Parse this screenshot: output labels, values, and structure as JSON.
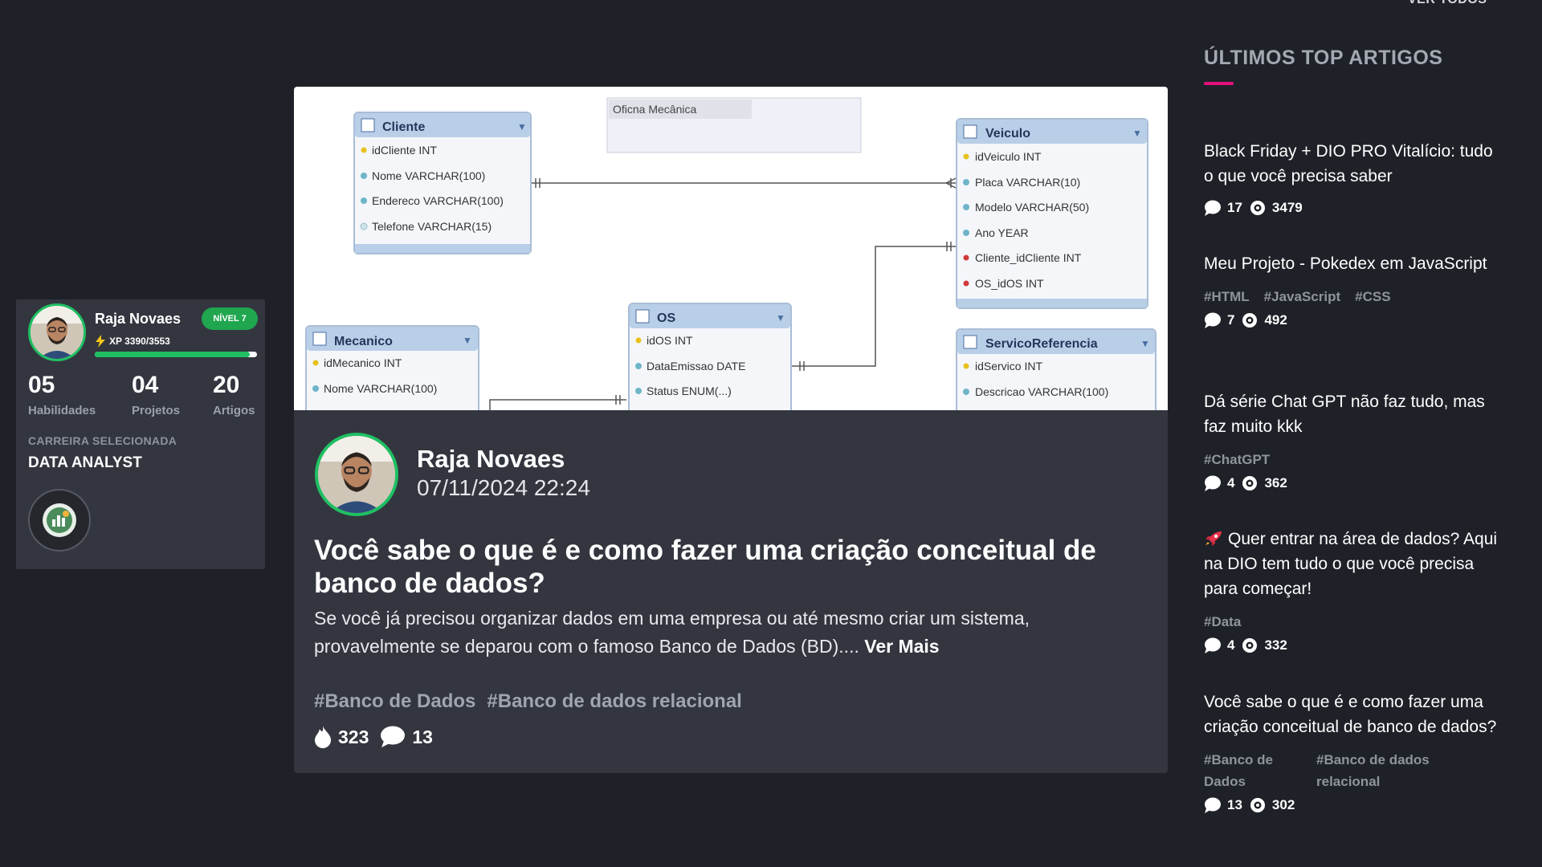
{
  "header": {
    "ver_todos": "VER TODOS"
  },
  "profile": {
    "name": "Raja Novaes",
    "level": "NÍVEL 7",
    "xp_text": "XP 3390/3553",
    "xp_progress": 0.954,
    "stats": [
      {
        "value": "05",
        "label": "Habilidades"
      },
      {
        "value": "04",
        "label": "Projetos"
      },
      {
        "value": "20",
        "label": "Artigos"
      }
    ],
    "career_label": "CARREIRA SELECIONADA",
    "career_value": "DATA ANALYST",
    "career_icon": "chart-badge-icon"
  },
  "diagram": {
    "group_label": "Oficna Mecânica",
    "tables": [
      {
        "name": "Cliente",
        "fields": [
          "idCliente INT",
          "Nome VARCHAR(100)",
          "Endereco VARCHAR(100)",
          "Telefone VARCHAR(15)"
        ]
      },
      {
        "name": "Veiculo",
        "fields": [
          "idVeiculo INT",
          "Placa VARCHAR(10)",
          "Modelo VARCHAR(50)",
          "Ano YEAR",
          "Cliente_idCliente INT",
          "OS_idOS INT"
        ]
      },
      {
        "name": "OS",
        "fields": [
          "idOS INT",
          "DataEmissao DATE",
          "Status ENUM(...)"
        ]
      },
      {
        "name": "Mecanico",
        "fields": [
          "idMecanico INT",
          "Nome VARCHAR(100)"
        ]
      },
      {
        "name": "ServicoReferencia",
        "fields": [
          "idServico INT",
          "Descricao VARCHAR(100)"
        ]
      }
    ]
  },
  "article": {
    "author": "Raja Novaes",
    "date": "07/11/2024 22:24",
    "title": "Você sabe o que é e como fazer uma criação conceitual de banco de dados?",
    "excerpt": "Se você já precisou organizar dados em uma empresa ou até mesmo criar um sistema, provavelmente se deparou com o famoso Banco de Dados (BD)....",
    "ver_mais": "Ver Mais",
    "tags": [
      "#Banco de Dados",
      "#Banco de dados relacional"
    ],
    "likes": "323",
    "comments": "13"
  },
  "sidebar": {
    "title": "ÚLTIMOS TOP ARTIGOS",
    "articles": [
      {
        "title": "Black Friday + DIO PRO Vitalício: tudo o que você precisa saber",
        "tags": [],
        "comments": "17",
        "views": "3479"
      },
      {
        "title": "Meu Projeto - Pokedex em JavaScript",
        "tags": [
          "#HTML",
          "#JavaScript",
          "#CSS"
        ],
        "comments": "7",
        "views": "492"
      },
      {
        "title": "Dá série Chat GPT não faz tudo, mas faz muito kkk",
        "tags": [
          "#ChatGPT"
        ],
        "comments": "4",
        "views": "362"
      },
      {
        "title": "Quer entrar na área de dados? Aqui na DIO tem tudo o que você precisa para começar!",
        "tags": [
          "#Data"
        ],
        "comments": "4",
        "views": "332"
      },
      {
        "title": "Você sabe o que é e como fazer uma criação conceitual de banco de dados?",
        "tags": [
          "#Banco de Dados",
          "#Banco de dados relacional"
        ],
        "comments": "13",
        "views": "302"
      }
    ]
  },
  "colors": {
    "accent_green": "#1fbf62",
    "accent_pink": "#e4107a",
    "card_bg": "#33363f",
    "page_bg": "#1f2128"
  }
}
